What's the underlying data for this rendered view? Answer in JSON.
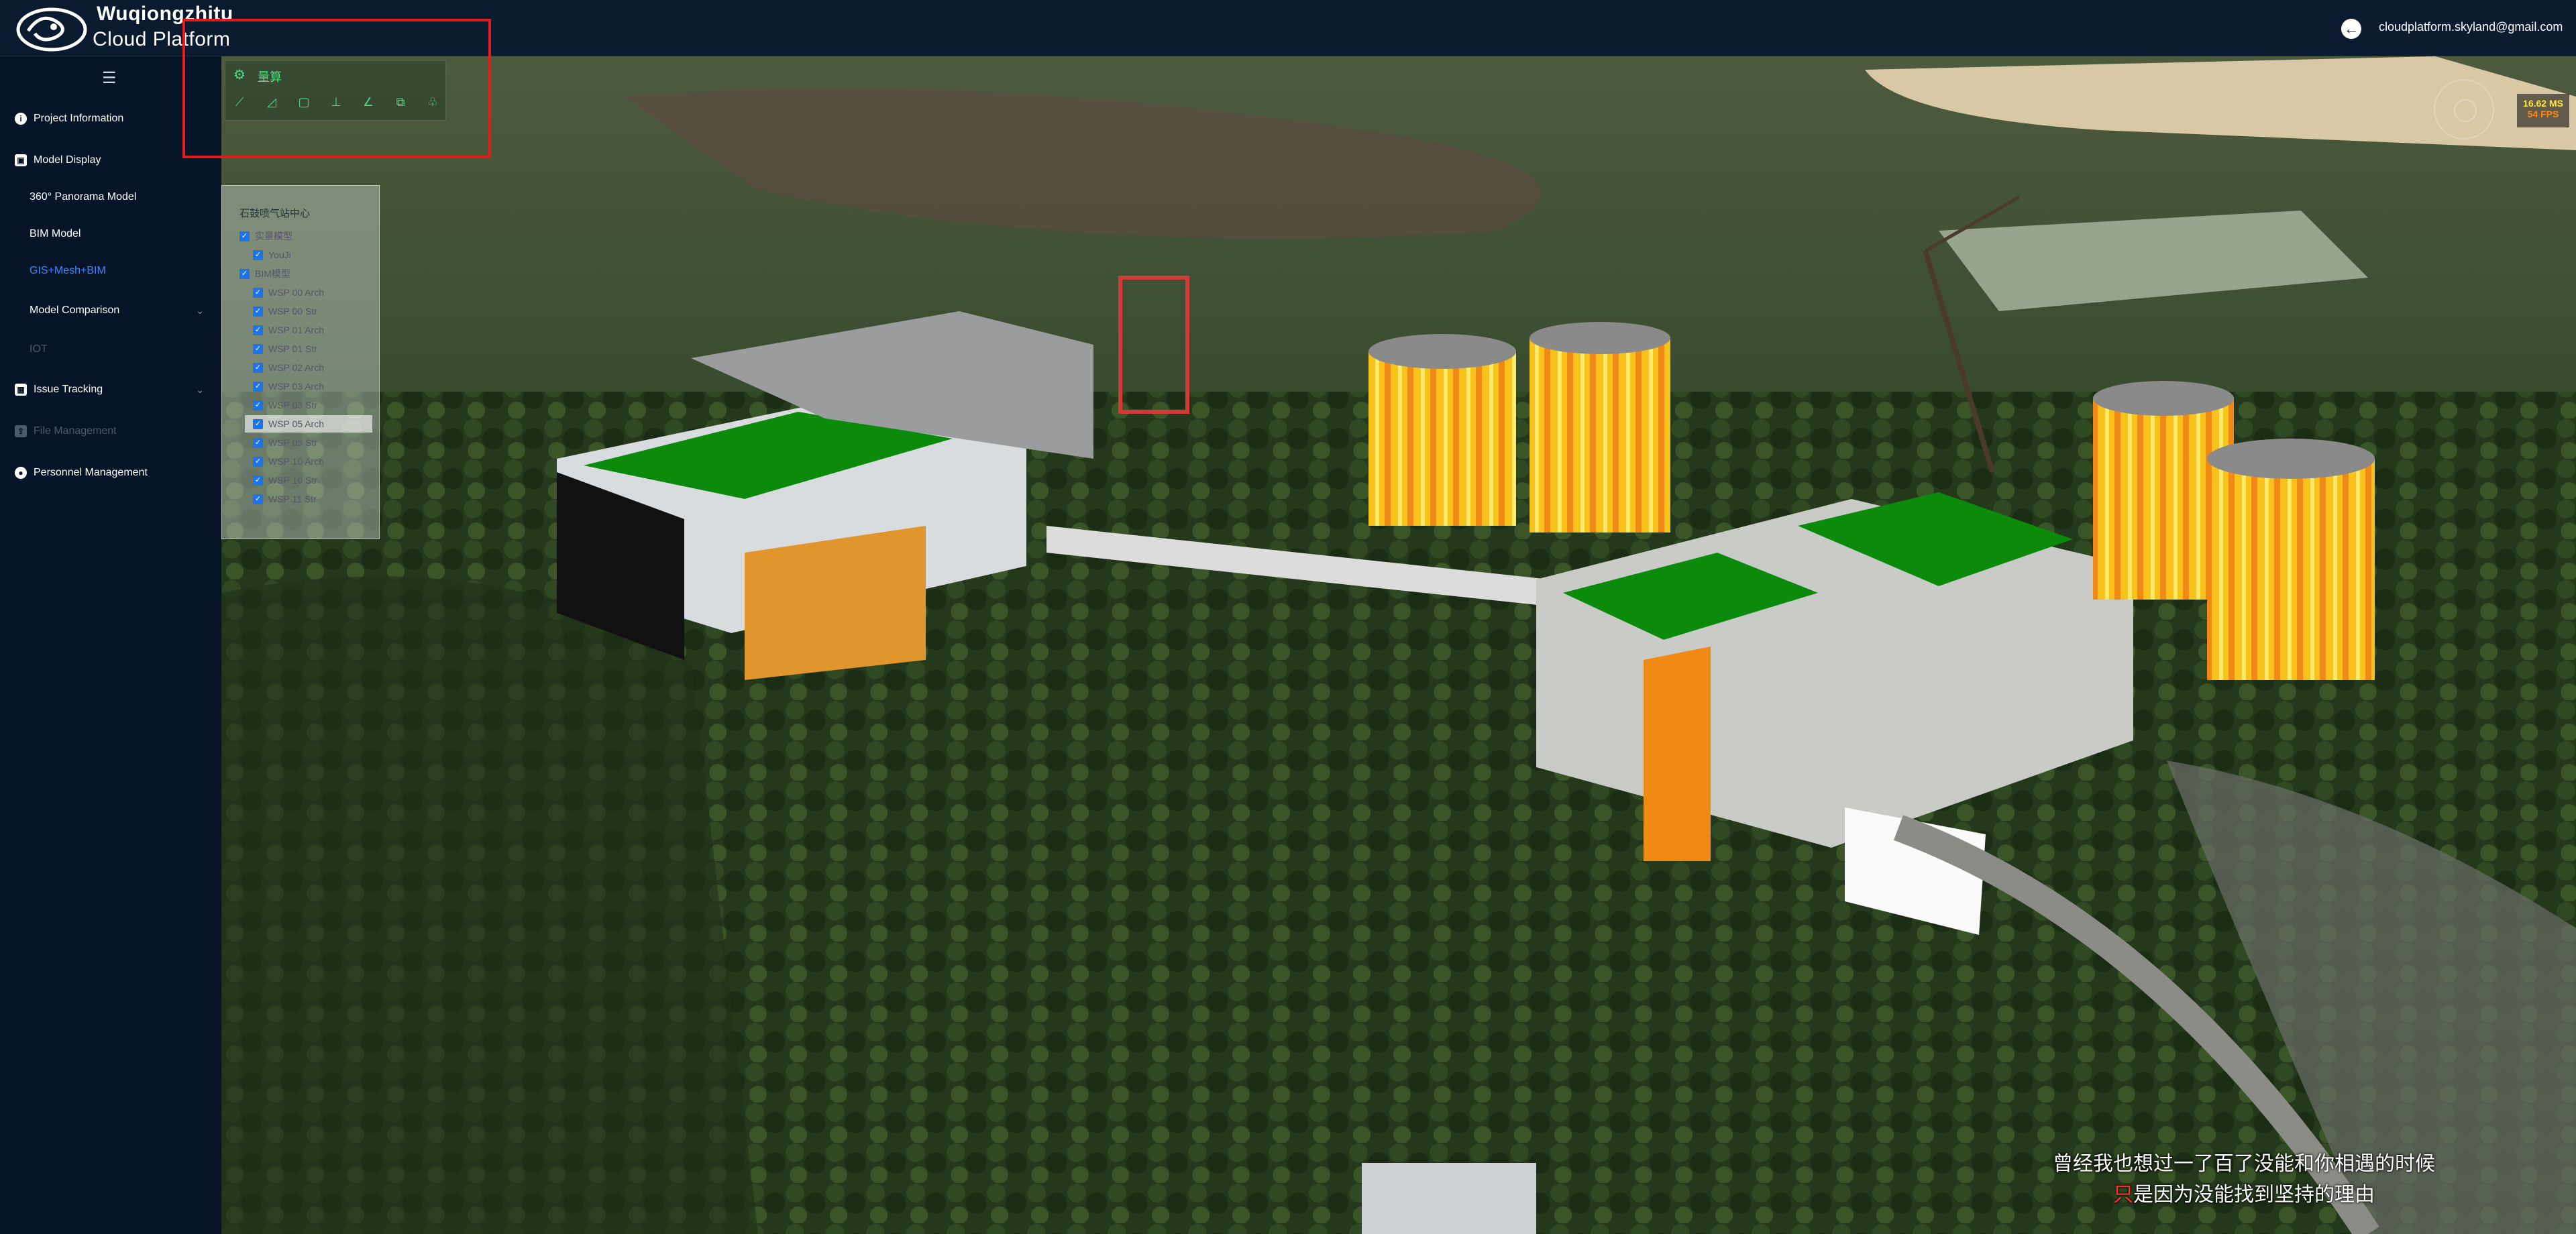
{
  "header": {
    "brand_line1": "Wuqiongzhitu",
    "brand_line2": "Cloud Platform",
    "user_email": "cloudplatform.skyland@gmail.com",
    "back_icon": "arrow-left-icon"
  },
  "sidebar": {
    "menu_icon": "☰",
    "items": [
      {
        "label": "Project Information",
        "icon": "info-icon",
        "state": "normal"
      },
      {
        "label": "Model Display",
        "icon": "display-icon",
        "state": "normal"
      },
      {
        "label": "360° Panorama Model",
        "state": "sub"
      },
      {
        "label": "BIM Model",
        "state": "sub"
      },
      {
        "label": "GIS+Mesh+BIM",
        "state": "active"
      },
      {
        "label": "Model Comparison",
        "state": "sub"
      },
      {
        "label": "IOT",
        "state": "disabled"
      },
      {
        "label": "Issue Tracking",
        "icon": "grid-icon",
        "state": "normal"
      },
      {
        "label": "File Management",
        "icon": "upload-icon",
        "state": "disabled"
      },
      {
        "label": "Personnel Management",
        "icon": "user-icon",
        "state": "normal"
      }
    ]
  },
  "toolbar": {
    "title": "量算",
    "gear_icon": "gear-icon",
    "tools": [
      "ruler-icon",
      "area-icon",
      "box-icon",
      "height-icon",
      "angle-icon",
      "layer-icon",
      "tree-icon"
    ]
  },
  "tree": {
    "root": "石鼓喷气站中心",
    "nodes": [
      {
        "label": "实景模型",
        "level": 1
      },
      {
        "label": "YouJi",
        "level": 2
      },
      {
        "label": "BIM模型",
        "level": 1
      },
      {
        "label": "WSP 00 Arch",
        "level": 2
      },
      {
        "label": "WSP 00 Str",
        "level": 2
      },
      {
        "label": "WSP 01 Arch",
        "level": 2
      },
      {
        "label": "WSP 01 Str",
        "level": 2
      },
      {
        "label": "WSP 02 Arch",
        "level": 2
      },
      {
        "label": "WSP 03 Arch",
        "level": 2
      },
      {
        "label": "WSP 03 Str",
        "level": 2
      },
      {
        "label": "WSP 05 Arch",
        "level": 2
      },
      {
        "label": "WSP 05 Str",
        "level": 2
      },
      {
        "label": "WSP 10 Arch",
        "level": 2
      },
      {
        "label": "WSP 10 Str",
        "level": 2
      },
      {
        "label": "WSP 11 Str",
        "level": 2
      }
    ]
  },
  "perf": {
    "ms": "16.62 MS",
    "fps": "54 FPS"
  },
  "subtitles": {
    "line1": "曾经我也想过一了百了没能和你相遇的时候",
    "line2_red": "只",
    "line2_rest": "是因为没能找到坚持的理由"
  },
  "colors": {
    "topbar": "#0a1a2f",
    "sidebar": "#051427",
    "active": "#3d8bff",
    "tool_green": "#4ade80",
    "highlight_red": "#e21b1b"
  }
}
